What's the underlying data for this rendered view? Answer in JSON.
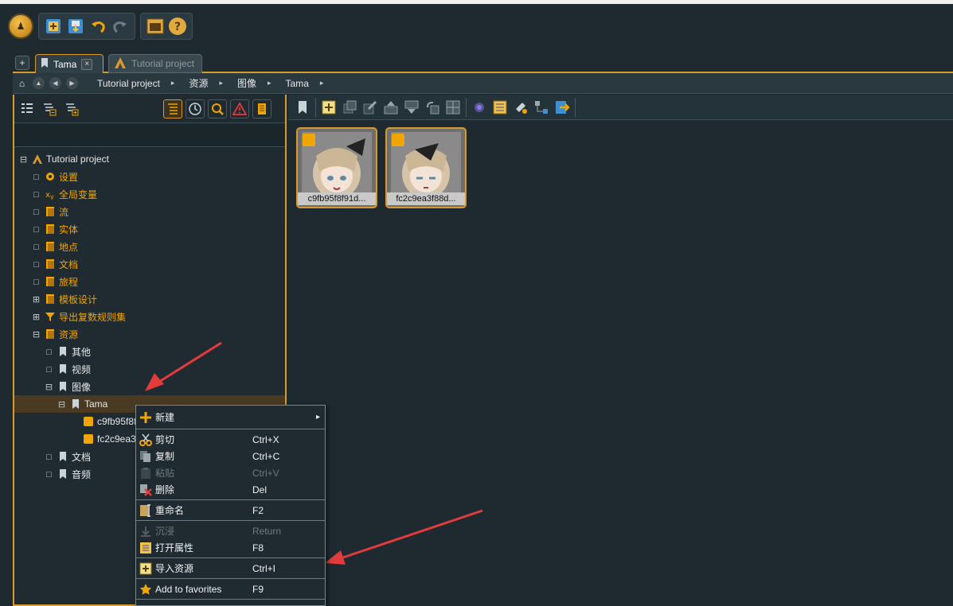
{
  "tabs": {
    "new_tab_label": "+",
    "active": "Tama",
    "close": "×",
    "inactive": "Tutorial project"
  },
  "breadcrumb": {
    "items": [
      "Tutorial project",
      "资源",
      "图像",
      "Tama"
    ],
    "separator": "▸"
  },
  "tree": [
    {
      "label": "Tutorial project",
      "depth": 0,
      "expander": "⊟",
      "color": "white",
      "icon": "project-icon"
    },
    {
      "label": "设置",
      "depth": 1,
      "expander": "□",
      "color": "orange",
      "icon": "gear-icon"
    },
    {
      "label": "全局变量",
      "depth": 1,
      "expander": "□",
      "color": "orange",
      "icon": "variable-icon"
    },
    {
      "label": "流",
      "depth": 1,
      "expander": "□",
      "color": "orange",
      "icon": "flow-icon"
    },
    {
      "label": "实体",
      "depth": 1,
      "expander": "□",
      "color": "orange",
      "icon": "entity-icon"
    },
    {
      "label": "地点",
      "depth": 1,
      "expander": "□",
      "color": "orange",
      "icon": "location-icon"
    },
    {
      "label": "文档",
      "depth": 1,
      "expander": "□",
      "color": "orange",
      "icon": "document-icon"
    },
    {
      "label": "旅程",
      "depth": 1,
      "expander": "□",
      "color": "orange",
      "icon": "journey-icon"
    },
    {
      "label": "模板设计",
      "depth": 1,
      "expander": "⊞",
      "color": "orange",
      "icon": "template-icon"
    },
    {
      "label": "导出复数规则集",
      "depth": 1,
      "expander": "⊞",
      "color": "orange",
      "icon": "filter-icon"
    },
    {
      "label": "资源",
      "depth": 1,
      "expander": "⊟",
      "color": "orange",
      "icon": "folder-icon"
    },
    {
      "label": "其他",
      "depth": 2,
      "expander": "□",
      "color": "white",
      "icon": "bookmark-icon"
    },
    {
      "label": "视频",
      "depth": 2,
      "expander": "□",
      "color": "white",
      "icon": "bookmark-icon"
    },
    {
      "label": "图像",
      "depth": 2,
      "expander": "⊟",
      "color": "white",
      "icon": "bookmark-icon"
    },
    {
      "label": "Tama",
      "depth": 3,
      "expander": "⊟",
      "color": "white",
      "icon": "bookmark-icon",
      "selected": true
    },
    {
      "label": "c9fb95f8f91d",
      "depth": 4,
      "expander": "",
      "color": "white",
      "icon": "asset-icon"
    },
    {
      "label": "fc2c9ea3f88d",
      "depth": 4,
      "expander": "",
      "color": "white",
      "icon": "asset-icon"
    },
    {
      "label": "文档",
      "depth": 2,
      "expander": "□",
      "color": "white",
      "icon": "bookmark-icon"
    },
    {
      "label": "音频",
      "depth": 2,
      "expander": "□",
      "color": "white",
      "icon": "bookmark-icon"
    }
  ],
  "assets": [
    {
      "caption": "c9fb95f8f91d..."
    },
    {
      "caption": "fc2c9ea3f88d..."
    }
  ],
  "context_menu": [
    {
      "label": "新建",
      "shortcut": "",
      "submenu": "▸",
      "enabled": true,
      "icon": "plus-icon"
    },
    {
      "label": "剪切",
      "shortcut": "Ctrl+X",
      "enabled": true,
      "icon": "scissors-icon"
    },
    {
      "label": "复制",
      "shortcut": "Ctrl+C",
      "enabled": true,
      "icon": "copy-icon"
    },
    {
      "label": "粘贴",
      "shortcut": "Ctrl+V",
      "enabled": false,
      "icon": "paste-icon"
    },
    {
      "label": "删除",
      "shortcut": "Del",
      "enabled": true,
      "icon": "delete-icon"
    },
    {
      "label": "重命名",
      "shortcut": "F2",
      "enabled": true,
      "icon": "rename-icon"
    },
    {
      "label": "沉浸",
      "shortcut": "Return",
      "enabled": false,
      "icon": "immerse-icon"
    },
    {
      "label": "打开属性",
      "shortcut": "F8",
      "enabled": true,
      "icon": "properties-icon"
    },
    {
      "label": "导入资源",
      "shortcut": "Ctrl+I",
      "enabled": true,
      "icon": "import-icon"
    },
    {
      "label": "Add to favorites",
      "shortcut": "F9",
      "enabled": true,
      "icon": "star-icon"
    }
  ],
  "colors": {
    "accent": "#d89a2b",
    "orange_text": "#f0a500",
    "background": "#1e2a30",
    "annotation_arrow": "#e23b3b"
  }
}
